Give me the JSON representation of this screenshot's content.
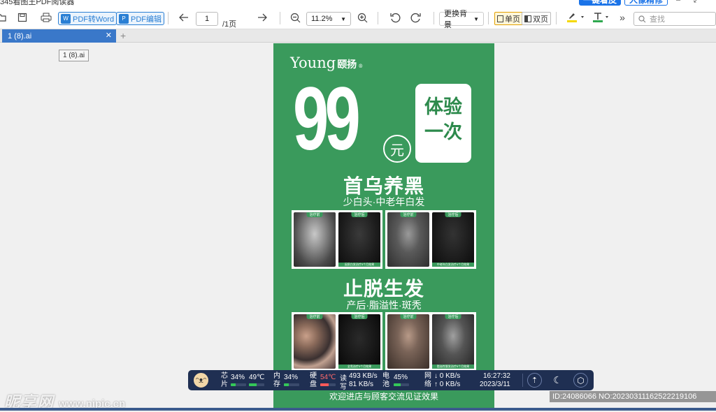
{
  "window": {
    "title": "345看图王PDF阅读器",
    "promo_buttons": [
      "一键着皮",
      "人像精修"
    ],
    "controls": [
      "–",
      "⤢"
    ]
  },
  "toolbar": {
    "pdf_to_word": "PDF转Word",
    "pdf_edit": "PDF编辑",
    "page_current": "1",
    "page_total": "/1页",
    "zoom": "11.2%",
    "background": "更换背景",
    "single_page": "单页",
    "double_page": "双页",
    "more": "»",
    "search_placeholder": "查找"
  },
  "tabs": [
    {
      "label": "1 (8).ai",
      "active": true
    }
  ],
  "tooltip": "1 (8).ai",
  "poster": {
    "brand": "Young",
    "brand_cn": "颐扬",
    "brand_reg": "®",
    "price": "99",
    "unit": "元",
    "offer_line1": "体验",
    "offer_line2": "一次",
    "section1_title": "首乌养黑",
    "section1_sub": "少白头·中老年白发",
    "section1_photos": [
      {
        "before": "治疗前",
        "after": "治疗后",
        "caption": "因家白发治疗3个月效果"
      },
      {
        "before": "治疗前",
        "after": "治疗后",
        "caption": "中老年白发治疗4个月效果"
      }
    ],
    "section2_title": "止脱生发",
    "section2_sub": "产后·脂溢性·斑秃",
    "section2_photos": [
      {
        "before": "治疗前",
        "after": "治疗后",
        "caption": "全秃治疗3个月效果"
      },
      {
        "before": "治疗前",
        "after": "治疗后",
        "caption": "脂溢性脱发治疗5个月效果"
      }
    ],
    "footer": "欢迎进店与顾客交流见证效果"
  },
  "monitor": {
    "cpu_label": [
      "芯",
      "片"
    ],
    "cpu_usage": "34%",
    "cpu_usage_pct": 34,
    "cpu_temp": "49℃",
    "mem_label": [
      "内",
      "存"
    ],
    "mem_usage": "34%",
    "mem_usage_pct": 34,
    "disk_label": [
      "硬",
      "盘"
    ],
    "disk_temp": "54℃",
    "disk_read_label": "读",
    "disk_read": "493 KB/s",
    "disk_write_label": "写",
    "disk_write": "81 KB/s",
    "battery_label": [
      "电",
      "池"
    ],
    "battery": "45%",
    "battery_pct": 45,
    "net_label": [
      "网",
      "络"
    ],
    "net_down": "↓  0 KB/s",
    "net_up": "↑  0 KB/s",
    "time": "16:27:32",
    "date": "2023/3/11"
  },
  "watermark": {
    "left": "昵享网",
    "left_url": "www.nipic.cn",
    "right": "ID:24086066 NO:20230311162522219106"
  },
  "colors": {
    "poster_green": "#3a9a5c",
    "tab_blue": "#3a78c9",
    "monitor_bg": "#1f2f52"
  }
}
